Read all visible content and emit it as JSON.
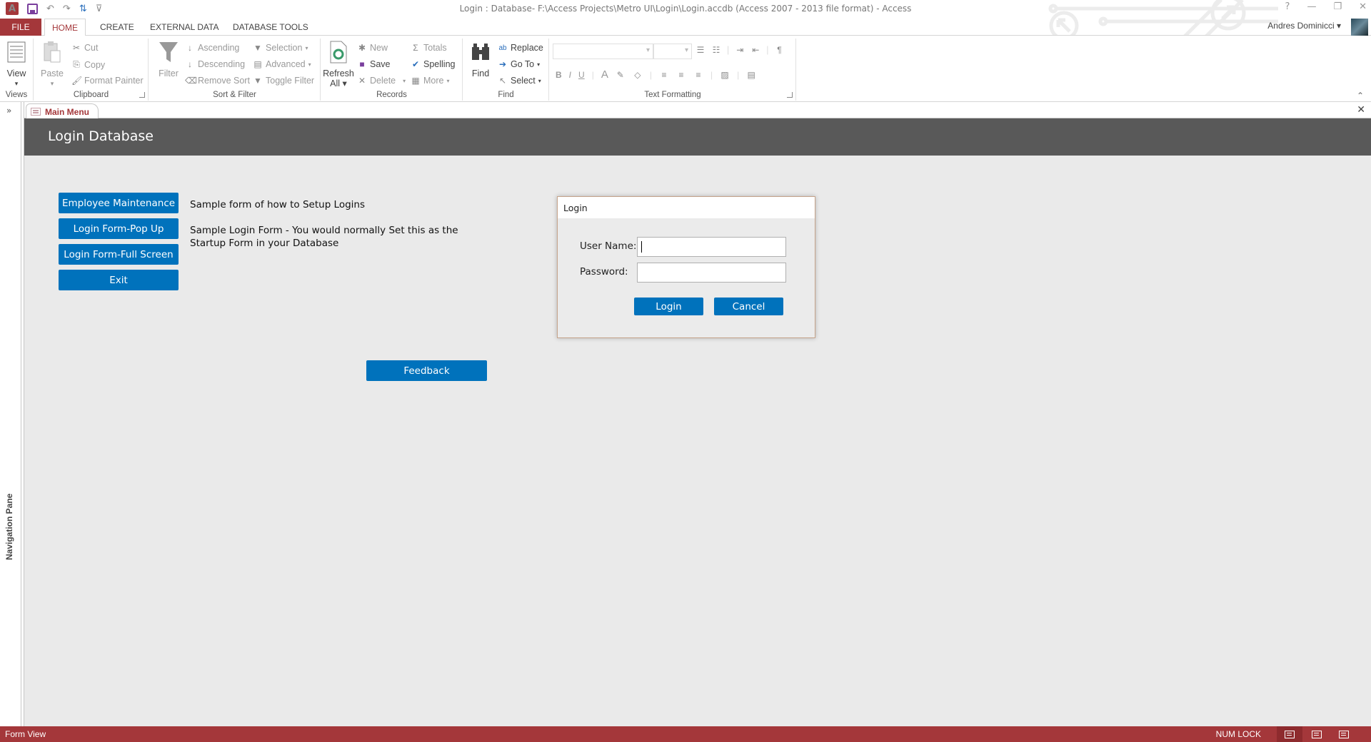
{
  "window": {
    "title": "Login : Database- F:\\Access Projects\\Metro UI\\Login\\Login.accdb (Access 2007 - 2013 file format) - Access",
    "user": "Andres Dominicci",
    "controls": {
      "help": "?",
      "minimize": "—",
      "restore": "❐",
      "close": "✕"
    }
  },
  "qat": {
    "app_icon": "A",
    "undo": "↶",
    "redo": "↷",
    "customize": "⇅",
    "more": "⊽"
  },
  "tabs": [
    {
      "label": "FILE"
    },
    {
      "label": "HOME",
      "active": true
    },
    {
      "label": "CREATE"
    },
    {
      "label": "EXTERNAL DATA"
    },
    {
      "label": "DATABASE TOOLS"
    }
  ],
  "ribbon": {
    "views": {
      "label": "Views",
      "view": "View"
    },
    "clipboard": {
      "label": "Clipboard",
      "paste": "Paste",
      "cut": "Cut",
      "copy": "Copy",
      "format_painter": "Format Painter"
    },
    "sort_filter": {
      "label": "Sort & Filter",
      "filter": "Filter",
      "ascending": "Ascending",
      "descending": "Descending",
      "remove_sort": "Remove Sort",
      "selection": "Selection",
      "advanced": "Advanced",
      "toggle_filter": "Toggle Filter"
    },
    "records": {
      "label": "Records",
      "refresh_1": "Refresh",
      "refresh_2": "All",
      "new": "New",
      "save": "Save",
      "delete": "Delete",
      "totals": "Totals",
      "spelling": "Spelling",
      "more": "More"
    },
    "find": {
      "label": "Find",
      "find": "Find",
      "replace": "Replace",
      "goto": "Go To",
      "select": "Select"
    },
    "text_formatting": {
      "label": "Text Formatting",
      "bold": "B",
      "italic": "I",
      "underline": "U",
      "font_color": "A"
    }
  },
  "nav_pane": {
    "label": "Navigation Pane",
    "expand": "»"
  },
  "document": {
    "tab_label": "Main Menu",
    "close": "✕",
    "header_title": "Login Database",
    "buttons": [
      {
        "label": "Employee Maintenance"
      },
      {
        "label": "Login Form-Pop Up"
      },
      {
        "label": "Login Form-Full Screen"
      },
      {
        "label": "Exit"
      }
    ],
    "descriptions": [
      "Sample form of how to Setup Logins",
      "Sample Login Form - You would normally Set this as the Startup Form in your Database"
    ],
    "feedback": "Feedback"
  },
  "login_dialog": {
    "title": "Login",
    "username_label": "User Name:",
    "username_value": "",
    "password_label": "Password:",
    "password_value": "",
    "login_button": "Login",
    "cancel_button": "Cancel"
  },
  "status": {
    "view": "Form View",
    "numlock": "NUM LOCK"
  },
  "colors": {
    "accent": "#a4373a",
    "button_blue": "#0072bc",
    "header_band": "#595959"
  }
}
